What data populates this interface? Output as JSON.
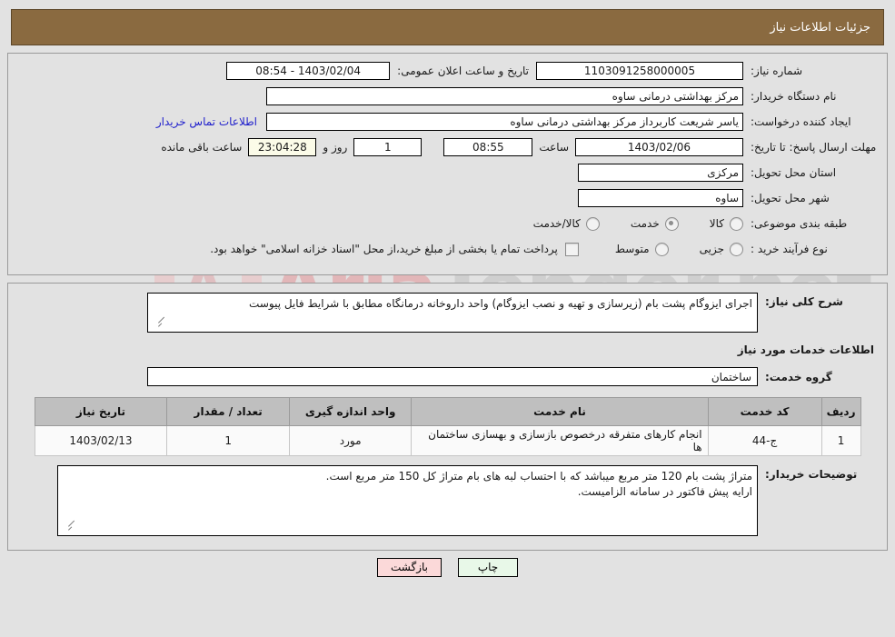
{
  "header": {
    "title": "جزئیات اطلاعات نیاز"
  },
  "info": {
    "need_number_label": "شماره نیاز:",
    "need_number_value": "1103091258000005",
    "public_announce_label": "تاریخ و ساعت اعلان عمومی:",
    "public_announce_value": "1403/02/04 - 08:54",
    "buyer_org_label": "نام دستگاه خریدار:",
    "buyer_org_value": "مرکز بهداشتی درمانی ساوه",
    "creator_label": "ایجاد کننده درخواست:",
    "creator_value": "یاسر شریعت کاربرداز مرکز بهداشتی درمانی ساوه",
    "buyer_contact_link": "اطلاعات تماس خریدار",
    "deadline_label": "مهلت ارسال پاسخ: تا تاریخ:",
    "deadline_date": "1403/02/06",
    "deadline_hour_label": "ساعت",
    "deadline_hour": "08:55",
    "remaining_days": "1",
    "remaining_days_label": "روز و",
    "remaining_time": "23:04:28",
    "remaining_time_label": "ساعت باقی مانده",
    "province_label": "استان محل تحویل:",
    "province_value": "مرکزی",
    "city_label": "شهر محل تحویل:",
    "city_value": "ساوه",
    "category_label": "طبقه بندی موضوعی:",
    "category_options": [
      {
        "label": "کالا",
        "checked": false
      },
      {
        "label": "خدمت",
        "checked": true
      },
      {
        "label": "کالا/خدمت",
        "checked": false
      }
    ],
    "process_label": "نوع فرآیند خرید :",
    "process_options": [
      {
        "label": "جزیی",
        "checked": false
      },
      {
        "label": "متوسط",
        "checked": false
      }
    ],
    "treasury_checkbox_text": "پرداخت تمام یا بخشی از مبلغ خرید،از محل \"اسناد خزانه اسلامی\" خواهد بود.",
    "treasury_checked": false
  },
  "description": {
    "general_need_label": "شرح کلی نیاز:",
    "general_need_value": "اجرای ایزوگام پشت بام (زیرسازی و تهیه و نصب ایزوگام) واحد داروخانه درمانگاه مطابق با شرایط فایل پیوست",
    "services_section_title": "اطلاعات خدمات مورد نیاز",
    "service_group_label": "گروه خدمت:",
    "service_group_value": "ساختمان",
    "buyer_notes_label": "توضیحات خریدار:",
    "buyer_notes_line1": "متراژ پشت بام 120 متر مربع میباشد که با احتساب لبه های  بام متراژ کل 150 متر مربع است.",
    "buyer_notes_line2": "ارایه پیش فاکتور در سامانه الزامیست."
  },
  "table": {
    "columns": [
      "ردیف",
      "کد خدمت",
      "نام خدمت",
      "واحد اندازه گیری",
      "تعداد / مقدار",
      "تاریخ نیاز"
    ],
    "rows": [
      {
        "radif": "1",
        "code": "ج-44",
        "name": "انجام کارهای متفرقه درخصوص بازسازی و بهسازی ساختمان ها",
        "unit": "مورد",
        "qty": "1",
        "date": "1403/02/13"
      }
    ]
  },
  "footer": {
    "print_label": "چاپ",
    "back_label": "بازگشت"
  },
  "watermark": {
    "text_left": "Aria",
    "text_right": "Tender.net"
  },
  "colors": {
    "header_bg": "#8a6a40",
    "page_bg": "#e2e2e2",
    "link": "#2020cc",
    "table_header_bg": "#bfbfbf",
    "print_btn_bg": "#e8f8e8",
    "back_btn_bg": "#fbd9d9",
    "countdown_bg": "#fbfbe8"
  }
}
